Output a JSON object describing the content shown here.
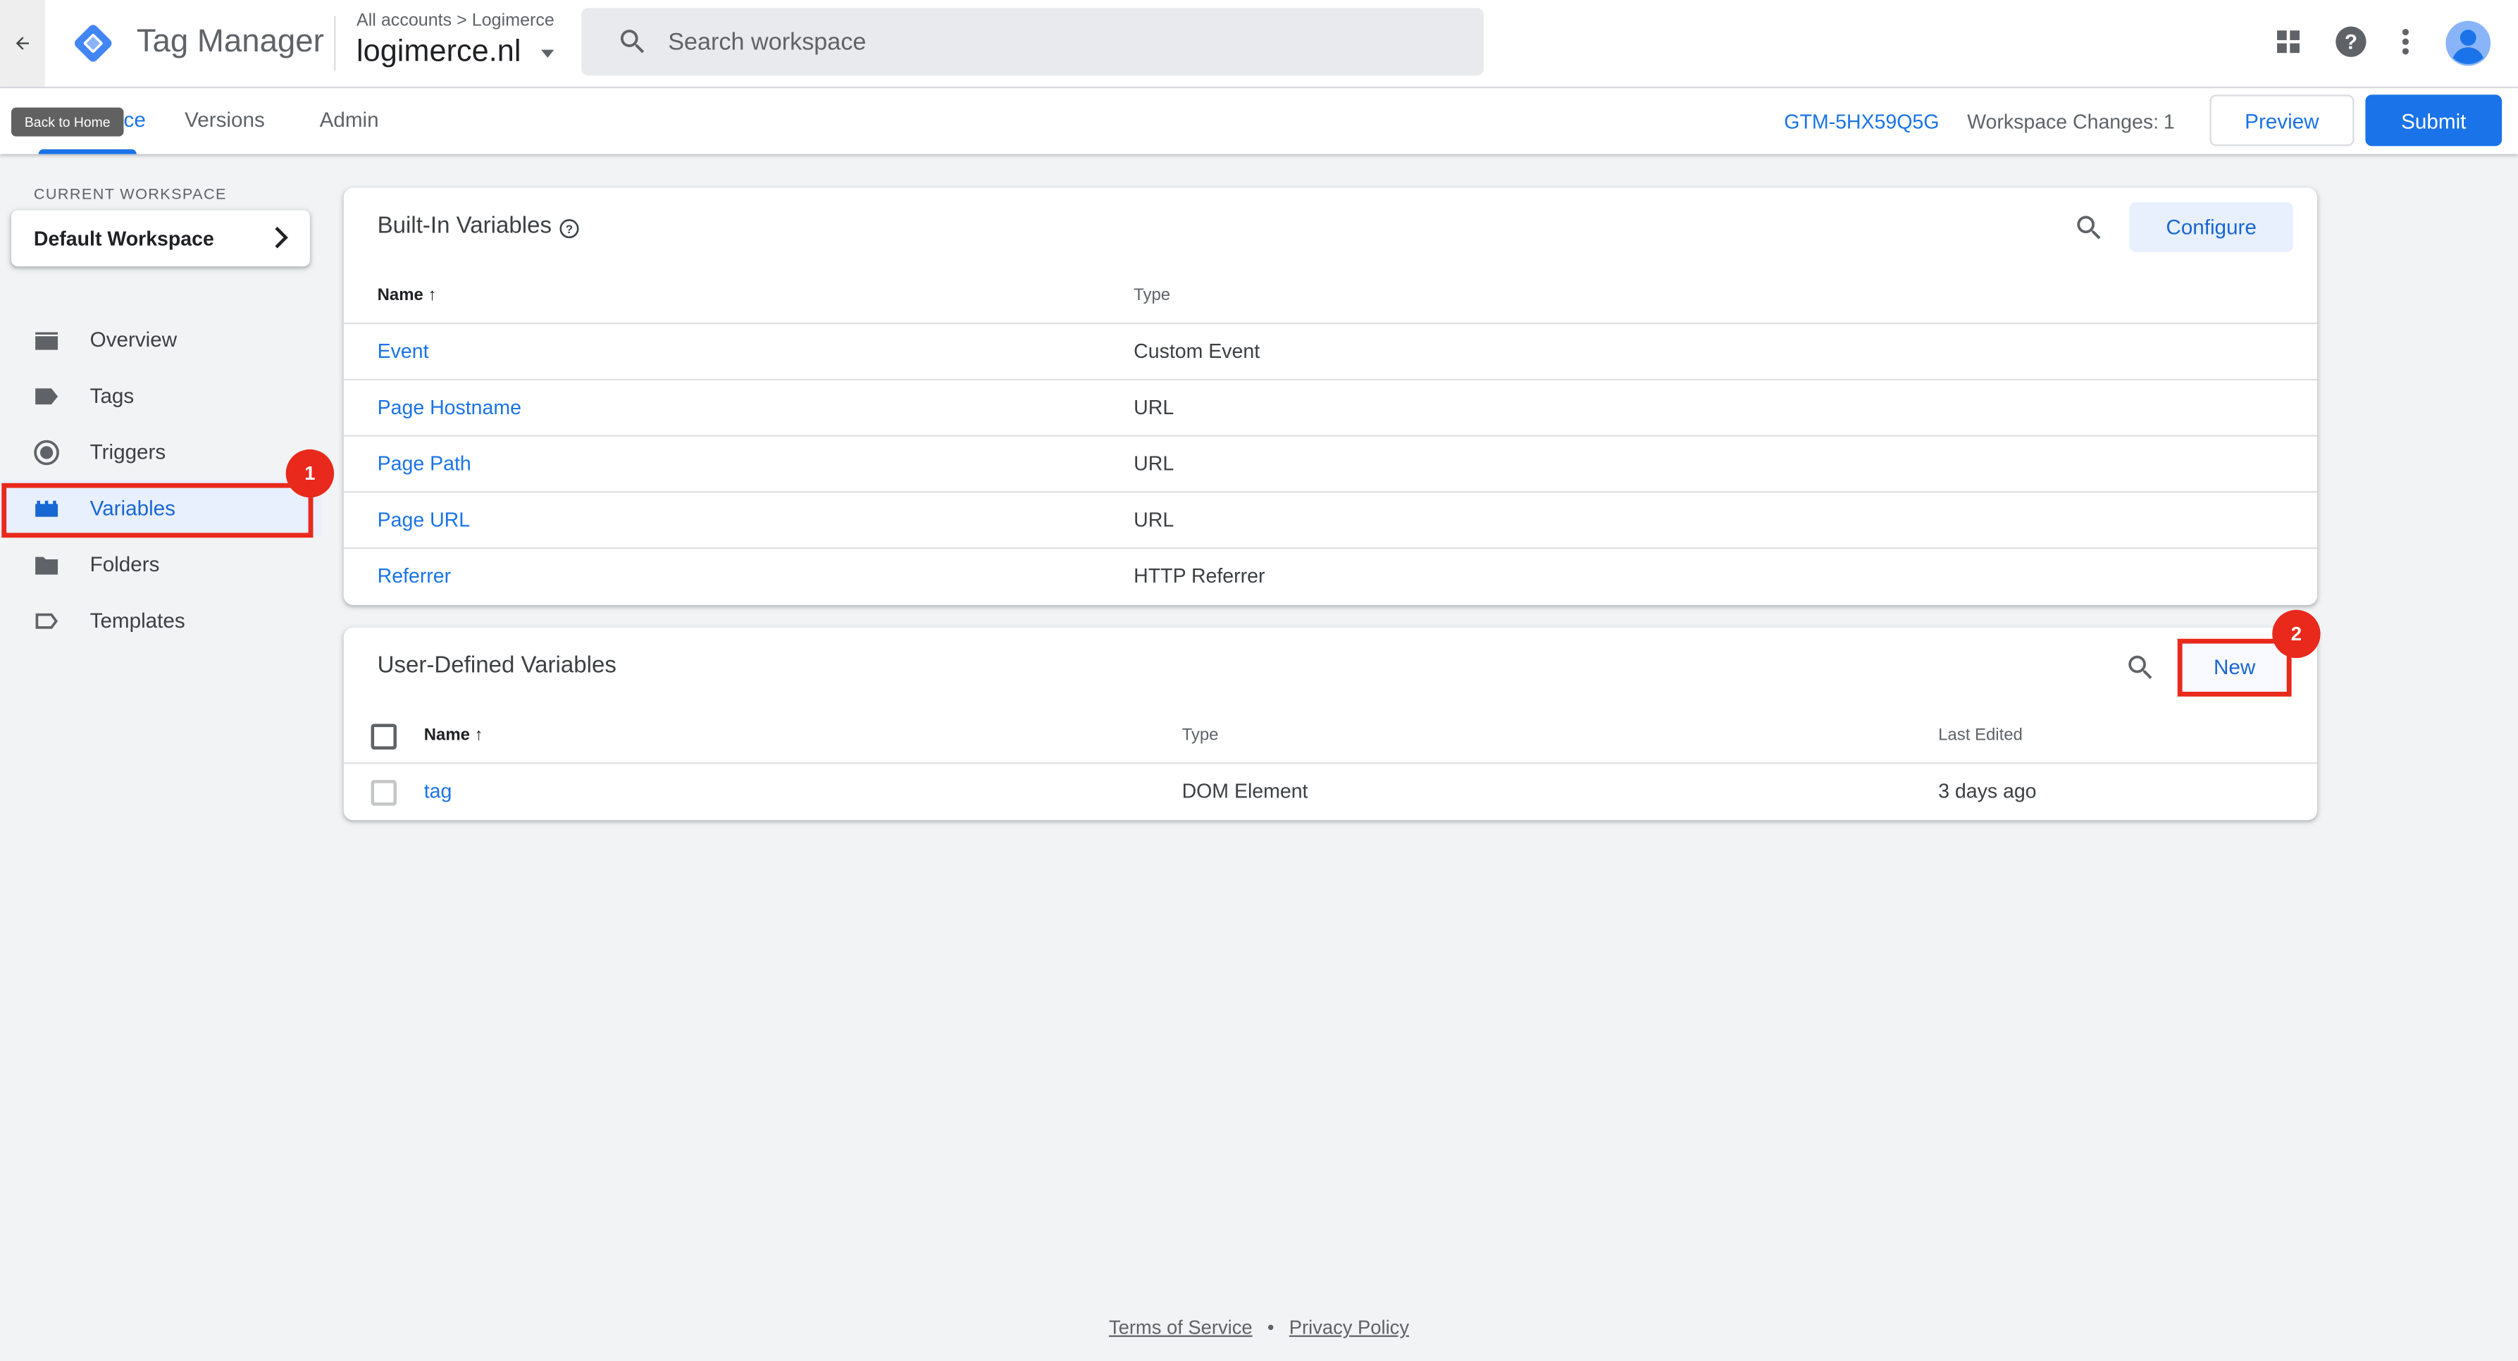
{
  "header": {
    "app_name": "Tag Manager",
    "breadcrumb_all": "All accounts",
    "breadcrumb_account": "Logimerce",
    "container_name": "logimerce.nl",
    "search_placeholder": "Search workspace",
    "back_tooltip": "Back to Home"
  },
  "subnav": {
    "tabs": [
      "Workspace",
      "Versions",
      "Admin"
    ],
    "tab_workspace_visible": "ce",
    "container_id": "GTM-5HX59Q5G",
    "workspace_changes_label": "Workspace Changes:",
    "workspace_changes_count": "1",
    "preview_label": "Preview",
    "submit_label": "Submit"
  },
  "sidebar": {
    "current_workspace_label": "CURRENT WORKSPACE",
    "workspace_name": "Default Workspace",
    "items": [
      {
        "label": "Overview",
        "icon": "overview-icon"
      },
      {
        "label": "Tags",
        "icon": "tag-icon"
      },
      {
        "label": "Triggers",
        "icon": "trigger-icon"
      },
      {
        "label": "Variables",
        "icon": "variables-icon",
        "active": true
      },
      {
        "label": "Folders",
        "icon": "folder-icon"
      },
      {
        "label": "Templates",
        "icon": "template-icon"
      }
    ]
  },
  "builtin": {
    "title": "Built-In Variables",
    "configure_label": "Configure",
    "col_name": "Name",
    "col_type": "Type",
    "rows": [
      {
        "name": "Event",
        "type": "Custom Event"
      },
      {
        "name": "Page Hostname",
        "type": "URL"
      },
      {
        "name": "Page Path",
        "type": "URL"
      },
      {
        "name": "Page URL",
        "type": "URL"
      },
      {
        "name": "Referrer",
        "type": "HTTP Referrer"
      }
    ]
  },
  "userdefined": {
    "title": "User-Defined Variables",
    "new_label": "New",
    "col_name": "Name",
    "col_type": "Type",
    "col_last_edited": "Last Edited",
    "rows": [
      {
        "name": "tag",
        "type": "DOM Element",
        "last_edited": "3 days ago"
      }
    ]
  },
  "annotations": {
    "badge_1": "1",
    "badge_2": "2",
    "color": "#e8291c"
  },
  "footer": {
    "terms": "Terms of Service",
    "separator": "•",
    "privacy": "Privacy Policy"
  },
  "colors": {
    "accent": "#1a73e8",
    "background": "#f1f3f4"
  }
}
